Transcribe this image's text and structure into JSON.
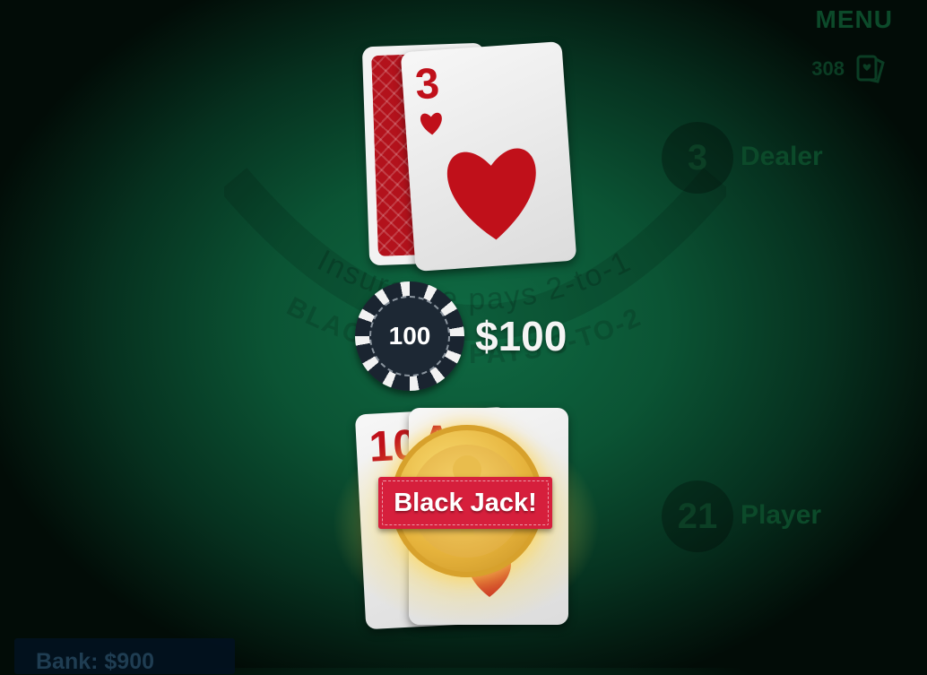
{
  "menu": {
    "label": "MENU"
  },
  "shoe": {
    "count": "308",
    "icon": "card-stack-icon"
  },
  "table": {
    "insurance_text": "Insurance pays 2-to-1",
    "blackjack_text": "BLACKJACK PAYS 3-TO-2"
  },
  "dealer": {
    "score": "3",
    "label": "Dealer",
    "cards": [
      {
        "face_down": true
      },
      {
        "rank": "3",
        "suit": "hearts"
      }
    ]
  },
  "bet": {
    "chip_value": "100",
    "amount": "$100"
  },
  "player": {
    "score": "21",
    "label": "Player",
    "cards": [
      {
        "rank": "10",
        "suit": "hearts"
      },
      {
        "rank": "A",
        "suit": "hearts"
      }
    ],
    "result": "Black Jack!"
  },
  "bank": {
    "label": "Bank: $900"
  },
  "colors": {
    "felt": "#0b5434",
    "card_red": "#c0101a",
    "banner": "#d61f3c",
    "coin_gold": "#e6b33c"
  }
}
